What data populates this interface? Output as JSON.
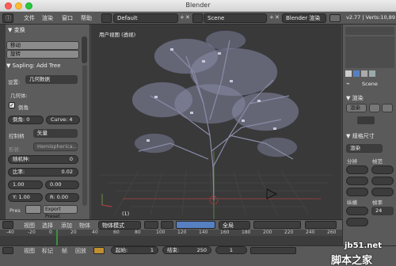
{
  "window": {
    "title": "Blender"
  },
  "info": {
    "menus": [
      "文件",
      "渲染",
      "窗口",
      "帮助"
    ],
    "layout": "Default",
    "scene": "Scene",
    "engine": "Blender 渲染",
    "stats": "v2.77 | Verts:10,89"
  },
  "toolshelf": {
    "transform_header": "▼ 变换",
    "move": "移动",
    "rotate": "旋转",
    "sapling_header": "▼ Sapling: Add Tree",
    "settings_label": "设置:",
    "settings_value": "几何数据",
    "geometry_label": "几何体:",
    "bevel_label": "倒角",
    "bevel_res": "倒角: 0",
    "curve_res": "Curve: 4",
    "handle_label": "控制柄",
    "handle_value": "矢量",
    "shape_label": "形状:",
    "shape_value": "Hemispherica...",
    "seed": "随机种:",
    "seed_val": "0",
    "ratio": "比率:",
    "ratio_val": "0.02",
    "scale_a": "1.00",
    "scale_b": "0.00",
    "y_a": "Y: 1.00",
    "r_a": "R: 0.00",
    "pres": "Pres",
    "export": "Export Preset"
  },
  "viewport": {
    "label": "用户视图 (透视)",
    "frame": "(1)"
  },
  "header3d": {
    "view": "视图",
    "select": "选择",
    "add": "添加",
    "object": "物体",
    "mode": "物体模式",
    "global": "全局"
  },
  "timeline": {
    "ticks": [
      "-40",
      "-20",
      "0",
      "20",
      "40",
      "60",
      "80",
      "100",
      "120",
      "140",
      "160",
      "180",
      "200",
      "220",
      "240",
      "260"
    ]
  },
  "tlhead": {
    "view": "视图",
    "marker": "标记",
    "frame": "帧",
    "play": "回放",
    "start": "起始:",
    "start_v": "1",
    "end": "结束:",
    "end_v": "250",
    "cur": "1"
  },
  "props": {
    "scene": "Scene",
    "render": "▼ 渲染",
    "dims": "▼ 规格尺寸",
    "render_btn": "渲染",
    "res_label": "分辨",
    "fr_label": "帧范",
    "aspect": "纵横",
    "fr_rate": "帧率",
    "fps": "24"
  },
  "watermark": {
    "site": "jb51.net",
    "name": "脚本之家"
  },
  "colors": {
    "bg": "#393939",
    "tree": "#8a8ca8",
    "accent": "#5680c2",
    "grid": "#474747"
  }
}
